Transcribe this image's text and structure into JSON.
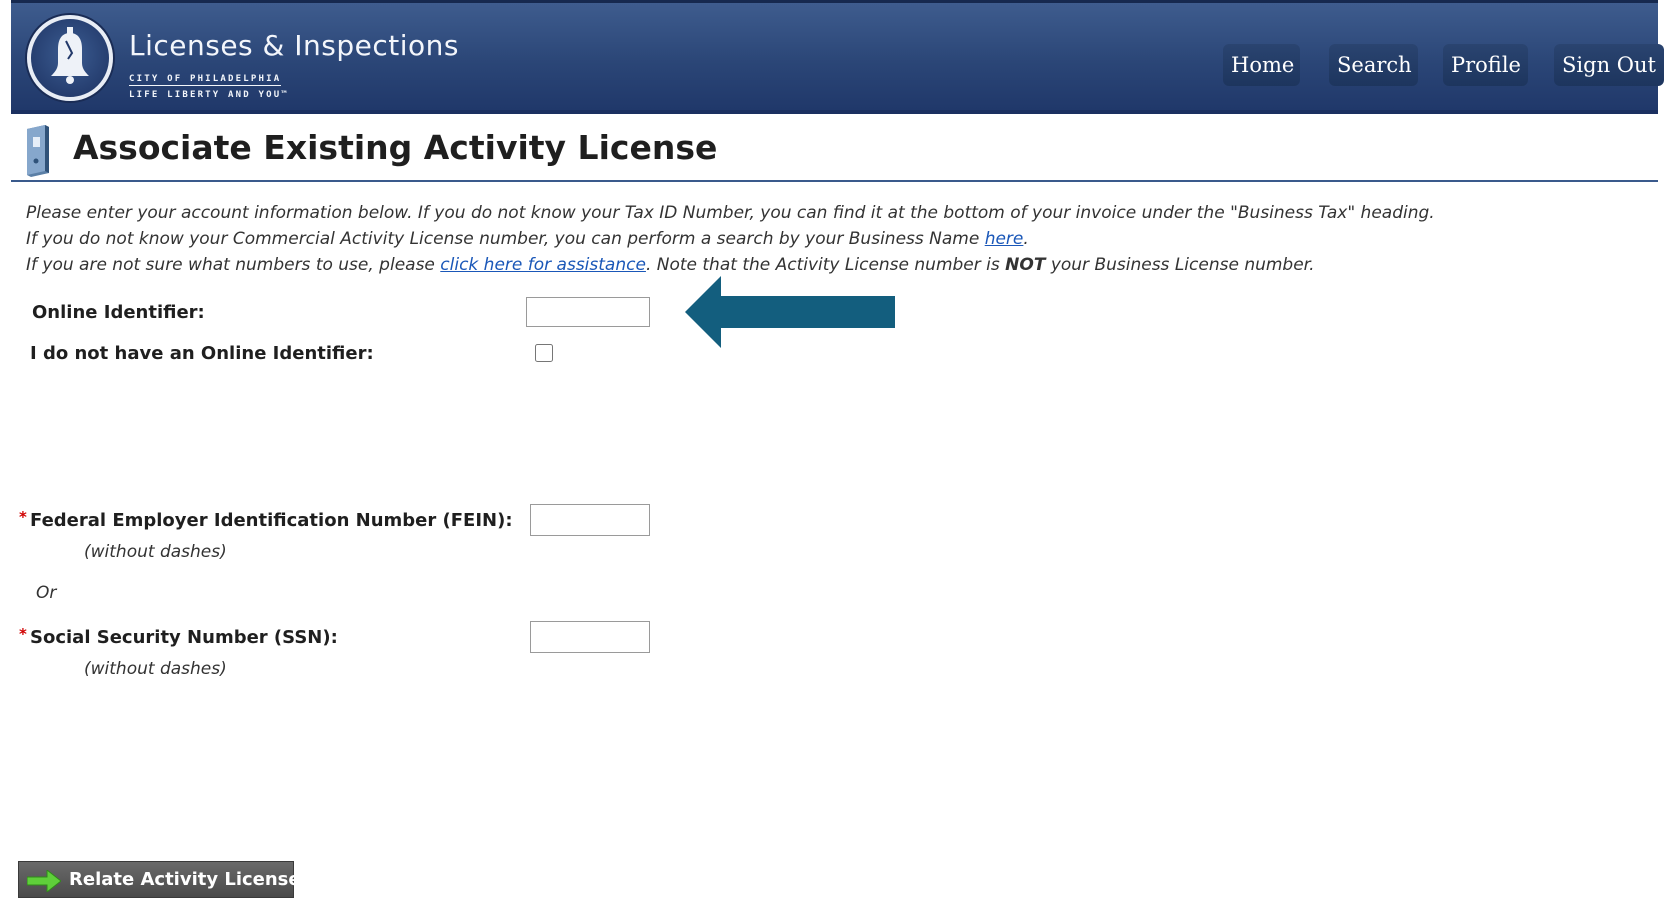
{
  "header": {
    "brand_title": "Licenses & Inspections",
    "brand_sub1": "CITY OF PHILADELPHIA",
    "brand_sub2": "LIFE LIBERTY AND YOU™",
    "nav": {
      "home": "Home",
      "search": "Search",
      "profile": "Profile",
      "sign_out": "Sign Out"
    },
    "colors": {
      "banner": "#2b4677",
      "nav_button": "#1d355e"
    }
  },
  "page": {
    "title": "Associate Existing Activity License",
    "title_icon": "binder-icon"
  },
  "instructions": {
    "line1": "Please enter your account information below. If you do not know your Tax ID Number, you can find it at the bottom of your invoice under the \"Business Tax\" heading.",
    "line2_prefix": "If you do not know your Commercial Activity License number, you can perform a search by your Business Name ",
    "line2_link": "here",
    "line2_suffix": ".",
    "line3_prefix": "If you are not sure what numbers to use, please ",
    "line3_link": "click here for assistance",
    "line3_mid": ". Note that the Activity License number is ",
    "line3_bold": "NOT",
    "line3_suffix": " your Business License number."
  },
  "form": {
    "online_identifier_label": "Online Identifier:",
    "online_identifier_value": "",
    "no_identifier_label": "I do not have an Online Identifier:",
    "no_identifier_checked": false,
    "required_marker": "*",
    "fein_label": "Federal Employer Identification Number (FEIN):",
    "fein_note": "(without dashes)",
    "fein_value": "",
    "or_text": "Or",
    "ssn_label": "Social Security Number (SSN):",
    "ssn_note": "(without dashes)",
    "ssn_value": ""
  },
  "annotation": {
    "arrow_icon": "left-arrow-callout-icon",
    "arrow_color": "#135e7e"
  },
  "actions": {
    "submit_label": "Relate Activity License",
    "submit_icon": "green-arrow-icon"
  }
}
